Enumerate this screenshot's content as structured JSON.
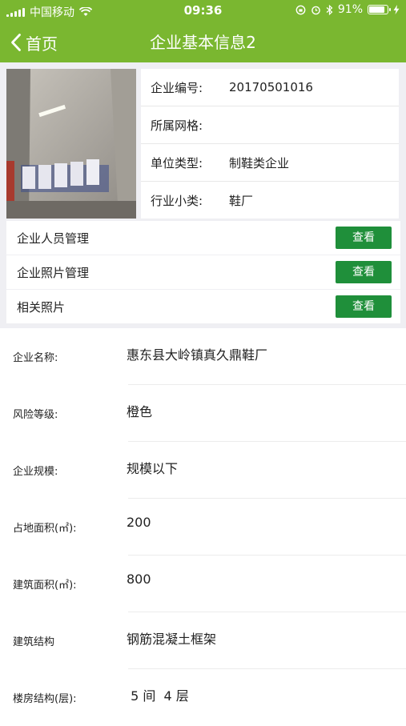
{
  "status_bar": {
    "carrier": "中国移动",
    "time": "09:36",
    "battery_percent": "91%",
    "battery_level": 0.91
  },
  "nav": {
    "back_label": "首页",
    "title": "企业基本信息2"
  },
  "info": {
    "rows": [
      {
        "label": "企业编号:",
        "value": "20170501016"
      },
      {
        "label": "所属网格:",
        "value": ""
      },
      {
        "label": "单位类型:",
        "value": "制鞋类企业"
      },
      {
        "label": "行业小类:",
        "value": "鞋厂"
      }
    ]
  },
  "management": {
    "rows": [
      {
        "label": "企业人员管理",
        "button": "查看"
      },
      {
        "label": "企业照片管理",
        "button": "查看"
      },
      {
        "label": "相关照片",
        "button": "查看"
      }
    ]
  },
  "details": {
    "rows": [
      {
        "label": "企业名称:",
        "value": "惠东县大岭镇真久鼎鞋厂"
      },
      {
        "label": "风险等级:",
        "value": "橙色"
      },
      {
        "label": "企业规模:",
        "value": "规模以下"
      },
      {
        "label": "占地面积(㎡):",
        "value": "200"
      },
      {
        "label": "建筑面积(㎡):",
        "value": "800"
      },
      {
        "label": "建筑结构",
        "value": "钢筋混凝土框架"
      },
      {
        "label": "楼房结构(层):",
        "value": " 5 间  4 层"
      }
    ]
  },
  "colors": {
    "header_green": "#7ab730",
    "button_green": "#1f8f3a"
  }
}
